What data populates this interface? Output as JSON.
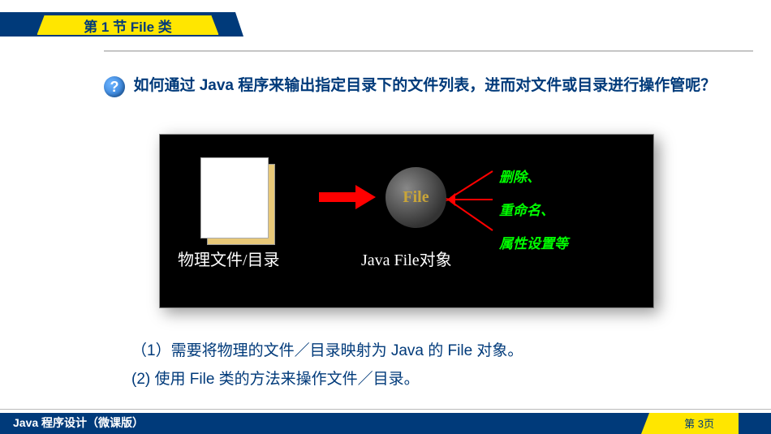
{
  "header": {
    "section_title": "第 1 节  File  类"
  },
  "question": {
    "icon_char": "?",
    "text": "如何通过 Java 程序来输出指定目录下的文件列表，进而对文件或目录进行操作管呢？"
  },
  "diagram": {
    "file_label": "物理文件/目录",
    "circle_label": "File",
    "java_obj_label": "Java File对象",
    "operations": [
      "删除、",
      "重命名、",
      "属性设置等"
    ]
  },
  "answers": {
    "line1": "（1）需要将物理的文件／目录映射为 Java 的 File 对象。",
    "line2": "(2)   使用 File 类的方法来操作文件／目录。"
  },
  "footer": {
    "left": "Java 程序设计（微课版）",
    "page": "第 3页"
  }
}
